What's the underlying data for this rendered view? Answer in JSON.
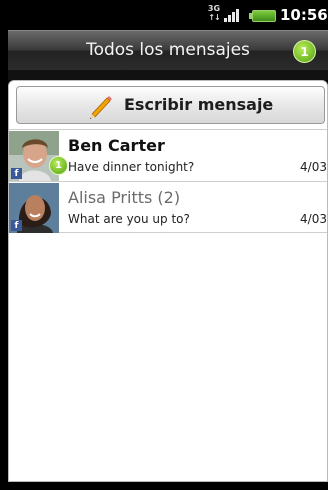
{
  "status_bar": {
    "network": "3G",
    "time": "10:56",
    "battery_color": "#5cb02a"
  },
  "header": {
    "title": "Todos los mensajes",
    "unread_count": "1"
  },
  "compose": {
    "label": "Escribir mensaje",
    "icon": "pencil-icon"
  },
  "conversations": [
    {
      "name": "Ben Carter",
      "preview": "Have dinner tonight?",
      "date": "4/03",
      "unread": "1",
      "source": "facebook"
    },
    {
      "name": "Alisa Pritts (2)",
      "preview": "What are you up to?",
      "date": "4/03",
      "source": "facebook"
    }
  ],
  "colors": {
    "accent_green": "#6fc127",
    "facebook_blue": "#3b5998"
  }
}
